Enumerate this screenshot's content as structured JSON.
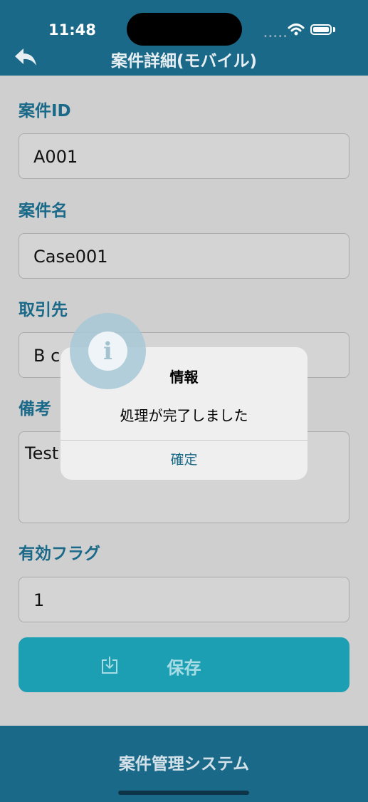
{
  "status_bar": {
    "time": "11:48",
    "signal": "•••••"
  },
  "header": {
    "title": "案件詳細(モバイル)"
  },
  "form": {
    "fields": [
      {
        "label": "案件ID",
        "value": "A001"
      },
      {
        "label": "案件名",
        "value": "Case001"
      },
      {
        "label": "取引先",
        "value": "B c"
      },
      {
        "label": "備考",
        "value": "Test"
      },
      {
        "label": "有効フラグ",
        "value": "1"
      }
    ],
    "save_label": "保存"
  },
  "footer": {
    "title": "案件管理システム"
  },
  "dialog": {
    "icon": "info-icon",
    "icon_glyph": "i",
    "title": "情報",
    "message": "処理が完了しました",
    "confirm_label": "確定"
  },
  "colors": {
    "primary": "#1b6989",
    "accent": "#1d9fb3",
    "background": "#cfcfcf"
  }
}
